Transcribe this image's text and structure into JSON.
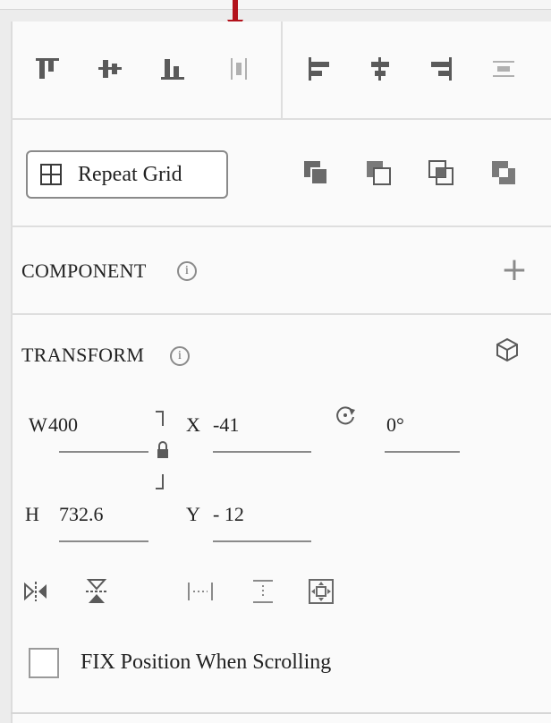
{
  "component": {
    "title": "COMPONENT",
    "info": "i"
  },
  "transform": {
    "title": "TRANSFORM",
    "info": "i",
    "width_label": "W",
    "width_value": "400",
    "x_label": "X",
    "x_value": "-41",
    "rotation_value": "0°",
    "height_label": "H",
    "height_value": "732.6",
    "y_label": "Y",
    "y_value": "- 12"
  },
  "repeat_grid": {
    "label": "Repeat Grid"
  },
  "fix_position": {
    "label": "FIX Position When Scrolling",
    "checked": false
  },
  "colors": {
    "arrow": "#b3121b",
    "icon": "#5a5a5a",
    "icon_light": "#b0b0b0"
  }
}
